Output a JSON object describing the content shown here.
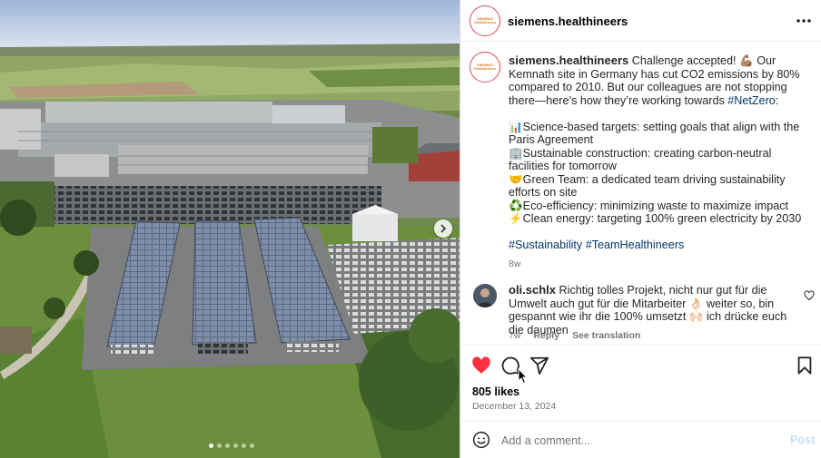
{
  "post": {
    "image_description_alt": "",
    "carousel": {
      "current": 1,
      "total": 6
    }
  },
  "header": {
    "username": "siemens.healthineers",
    "more_icon": "more-horizontal-icon"
  },
  "avatar_text": "SIEMENS Healthineers",
  "caption": {
    "username": "siemens.healthineers",
    "intro": " Challenge accepted! 💪🏽 Our Kemnath site in Germany has cut CO2 emissions by 80% compared to 2010. But our colleagues are not stopping there—here’s how they’re working towards ",
    "intro_tag": "#NetZero",
    "intro_end": ":",
    "items": [
      "📊Science-based targets: setting goals that align with the Paris Agreement",
      "🏢Sustainable construction: creating carbon-neutral facilities for tomorrow",
      "🤝Green Team: a dedicated team driving sustainability efforts on site",
      "♻️Eco-efficiency: minimizing waste to maximize impact",
      "⚡Clean energy: targeting 100% green electricity by 2030"
    ],
    "tag1": "#Sustainability",
    "tag2": "#TeamHealthineers",
    "age": "8w"
  },
  "comment": {
    "username": "oli.schlx",
    "text": " Richtig tolles Projekt, nicht nur gut für die Umwelt auch gut für die Mitarbeiter 👌🏻 weiter so, bin gespannt wie ihr die 100% umsetzt 🙌🏻 ich drücke euch die daumen",
    "age": "7w",
    "reply": "Reply",
    "translate": "See translation"
  },
  "actions": {
    "likes": "805 likes",
    "date": "December 13, 2024",
    "liked_color": "#ff3040"
  },
  "add_comment": {
    "placeholder": "Add a comment...",
    "post_label": "Post"
  }
}
